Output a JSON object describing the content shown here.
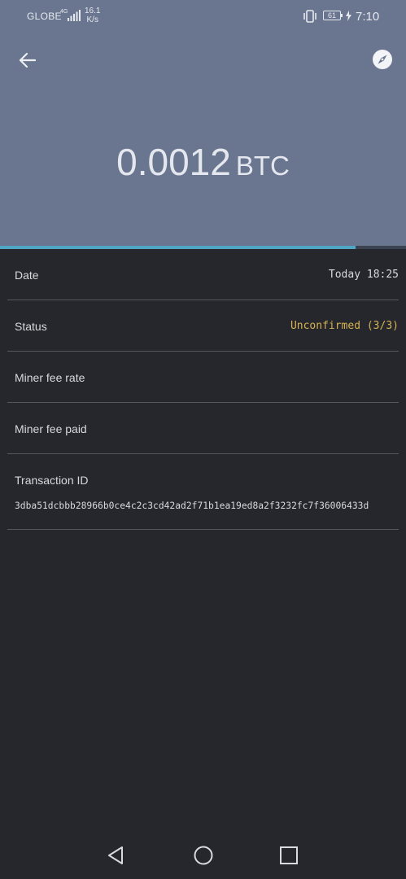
{
  "status_bar": {
    "carrier": "GLOBE",
    "network_type": "4G",
    "speed_value": "16.1",
    "speed_unit": "K/s",
    "battery": "61",
    "time": "7:10"
  },
  "header": {
    "amount_value": "0.0012",
    "amount_unit": "BTC",
    "confirmation_progress": 0.875
  },
  "details": {
    "date_label": "Date",
    "date_value": "Today 18:25",
    "status_label": "Status",
    "status_value": "Unconfirmed (3/3)",
    "fee_rate_label": "Miner fee rate",
    "fee_paid_label": "Miner fee paid",
    "txid_label": "Transaction ID",
    "txid_value": "3dba51dcbbb28966b0ce4c2c3cd42ad2f71b1ea19ed8a2f3232fc7f36006433d"
  },
  "icons": {
    "back": "arrow-left-icon",
    "explorer": "compass-icon",
    "nav_back": "triangle-back-icon",
    "nav_home": "circle-home-icon",
    "nav_recents": "square-recents-icon"
  },
  "colors": {
    "header_bg": "#6a7690",
    "body_bg": "#26272c",
    "accent": "#4ea6c4",
    "pending": "#d6b255"
  }
}
